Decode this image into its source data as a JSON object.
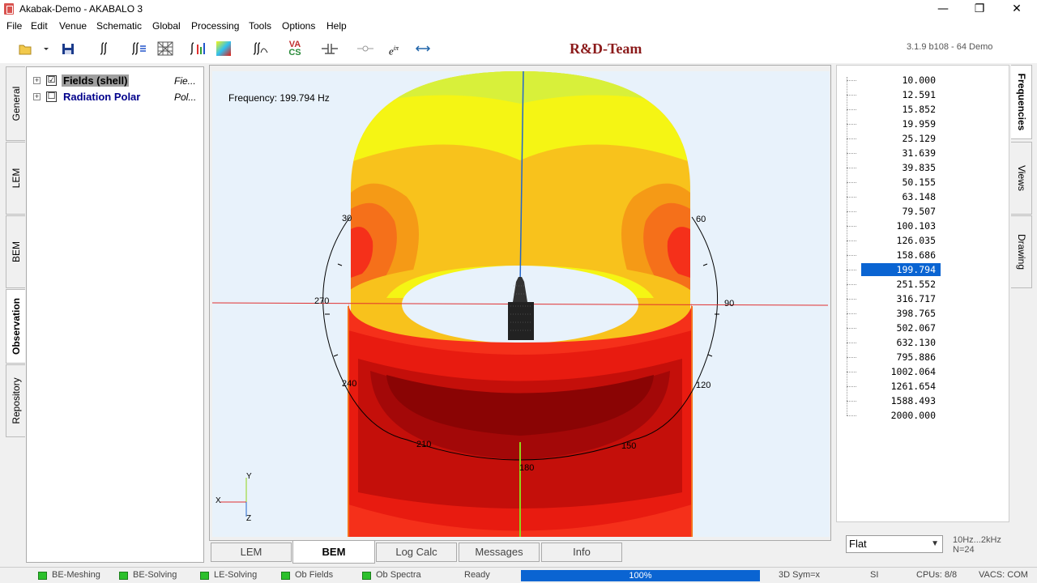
{
  "window": {
    "title": "Akabak-Demo - AKABALO 3",
    "minimize": "—",
    "maximize": "❐",
    "close": "✕"
  },
  "menu": [
    "File",
    "Edit",
    "Venue",
    "Schematic",
    "Global",
    "Processing",
    "Tools",
    "Options",
    "Help"
  ],
  "toolbar": {
    "brand": "R&D-Team",
    "version": "3.1.9 b108 - 64 Demo",
    "icons": [
      "open-folder-icon",
      "dropdown-arrow-icon",
      "save-icon",
      "integral-icon",
      "integral-list-icon",
      "mesh-icon",
      "integral-bars-icon",
      "color-map-icon",
      "integral-curve-icon",
      "vacs-icon",
      "component-icon",
      "node-icon",
      "complex-exp-icon",
      "swap-arrows-icon"
    ],
    "vacs_top": "VA",
    "vacs_bottom": "CS",
    "exp_label": "e",
    "exp_sup": "iπ"
  },
  "left_tabs": [
    "General",
    "LEM",
    "BEM",
    "Observation",
    "Repository"
  ],
  "left_tab_active": "Observation",
  "tree": [
    {
      "label": "Fields (shell)",
      "desc": "Fie...",
      "checked": "☑",
      "selected": true
    },
    {
      "label": "Radiation Polar",
      "desc": "Pol...",
      "checked": "☐",
      "selected": false
    }
  ],
  "viewport": {
    "frequency_label": "Frequency: 199.794 Hz",
    "polar_labels": [
      "30",
      "60",
      "270",
      "90",
      "240",
      "120",
      "210",
      "150",
      "180"
    ],
    "axis_labels": {
      "y": "Y",
      "x": "X",
      "z": "Z"
    },
    "colors": {
      "background": "#e8f2fb",
      "yellow_light": "#d8f03a",
      "yellow": "#f5f514",
      "orange_light": "#f8c21c",
      "orange": "#f59a16",
      "orange_dark": "#f5701a",
      "red_light": "#f5301a",
      "red": "#e81b10",
      "red_dark": "#c40f0a",
      "red_deep": "#a30808",
      "maroon": "#8a0404"
    }
  },
  "bottom_tabs": [
    "LEM",
    "BEM",
    "Log Calc",
    "Messages",
    "Info"
  ],
  "bottom_tab_active": "BEM",
  "right_tabs": [
    "Frequencies",
    "Views",
    "Drawing"
  ],
  "right_tab_active": "Frequencies",
  "frequencies": [
    "10.000",
    "12.591",
    "15.852",
    "19.959",
    "25.129",
    "31.639",
    "39.835",
    "50.155",
    "63.148",
    "79.507",
    "100.103",
    "126.035",
    "158.686",
    "199.794",
    "251.552",
    "316.717",
    "398.765",
    "502.067",
    "632.130",
    "795.886",
    "1002.064",
    "1261.654",
    "1588.493",
    "2000.000"
  ],
  "selected_frequency": "199.794",
  "scale_select": "Flat",
  "range_info": {
    "range": "10Hz...2kHz",
    "count": "N=24"
  },
  "status": {
    "items": [
      "BE-Meshing",
      "BE-Solving",
      "LE-Solving",
      "Ob Fields",
      "Ob Spectra"
    ],
    "state": "Ready",
    "progress_pct": 100,
    "progress": "100%",
    "symmetry": "3D Sym=x",
    "units": "SI",
    "cpus": "CPUs: 8/8",
    "vacs": "VACS: COM"
  }
}
